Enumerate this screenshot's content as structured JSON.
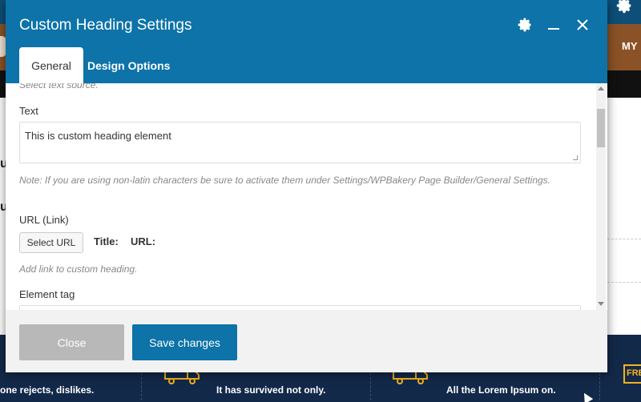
{
  "background": {
    "menu_item": "MY",
    "heading_fragment": "u",
    "footer_items": [
      "one rejects, dislikes.",
      "It has survived not only.",
      "All the Lorem Ipsum on."
    ],
    "free_badge": "FRE"
  },
  "modal": {
    "title": "Custom Heading Settings",
    "tabs": {
      "general": "General",
      "design": "Design Options"
    },
    "source_hint": "Select text source.",
    "text_label": "Text",
    "text_value": "This is custom heading element",
    "note": "Note: If you are using non-latin characters be sure to activate them under Settings/WPBakery Page Builder/General Settings.",
    "url_label": "URL (Link)",
    "select_url_button": "Select URL",
    "title_label": "Title:",
    "url_field_label": "URL:",
    "link_hint": "Add link to custom heading.",
    "element_tag_label": "Element tag",
    "close_button": "Close",
    "save_button": "Save changes"
  },
  "colors": {
    "header_blue": "#0d73a8",
    "close_grey": "#b8b8b8",
    "accent_yellow": "#f5b31c"
  }
}
